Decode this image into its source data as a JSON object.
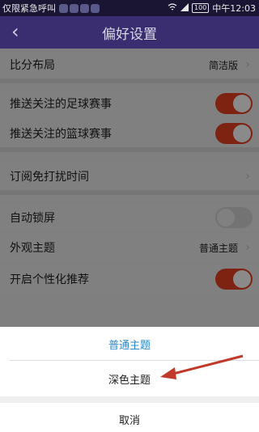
{
  "status_bar": {
    "carrier": "仅限紧急呼叫",
    "time": "中午12:03",
    "battery": "100"
  },
  "nav": {
    "title": "偏好设置"
  },
  "settings": {
    "layout_label": "比分布局",
    "layout_value": "简洁版",
    "push_football_label": "推送关注的足球赛事",
    "push_football_on": true,
    "push_basketball_label": "推送关注的篮球赛事",
    "push_basketball_on": true,
    "dnd_label": "订阅免打扰时间",
    "autolock_label": "自动锁屏",
    "autolock_on": false,
    "theme_label": "外观主题",
    "theme_value": "普通主题",
    "personalized_label": "开启个性化推荐",
    "personalized_on": true
  },
  "action_sheet": {
    "option_normal": "普通主题",
    "option_dark": "深色主题",
    "cancel": "取消"
  },
  "colors": {
    "nav_bg": "#3a2e70",
    "toggle_on": "#7e2312",
    "accent_option": "#2a87c7",
    "annotation_arrow": "#c0392b"
  }
}
